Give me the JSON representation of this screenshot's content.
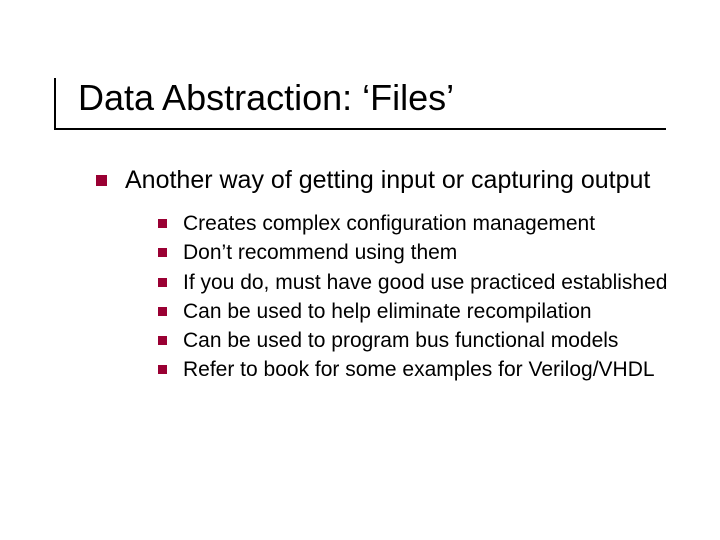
{
  "title": "Data Abstraction: ‘Files’",
  "bullets": [
    {
      "text": "Another way of getting input or capturing output",
      "children": [
        {
          "text": "Creates complex configuration management"
        },
        {
          "text": "Don’t recommend using them"
        },
        {
          "text": "If you do, must have good use practiced established"
        },
        {
          "text": "Can be used to help eliminate recompilation"
        },
        {
          "text": "Can be used to program bus functional models"
        },
        {
          "text": "Refer to book for some examples for Verilog/VHDL"
        }
      ]
    }
  ],
  "colors": {
    "bullet": "#9a0033",
    "rule": "#000000"
  }
}
